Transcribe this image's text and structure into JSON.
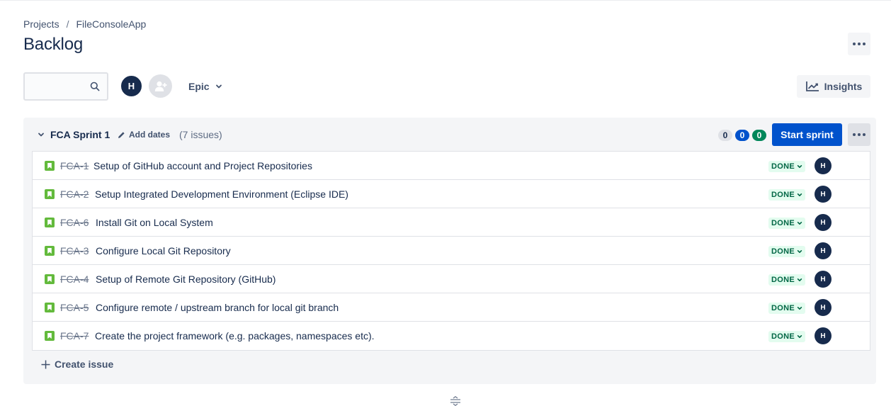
{
  "breadcrumb": {
    "projects": "Projects",
    "separator": "/",
    "project": "FileConsoleApp"
  },
  "page": {
    "title": "Backlog"
  },
  "toolbar": {
    "search_placeholder": "",
    "avatar_initial": "H",
    "epic_label": "Epic",
    "insights_label": "Insights"
  },
  "sprint": {
    "name": "FCA Sprint 1",
    "add_dates": "Add dates",
    "issue_count": "(7 issues)",
    "counts": {
      "todo": "0",
      "in_progress": "0",
      "done": "0"
    },
    "start_label": "Start sprint",
    "create_issue": "Create issue",
    "issues": [
      {
        "key": "FCA-1",
        "summary": "Setup of GitHub account and Project Repositories",
        "status": "DONE",
        "assignee": "H"
      },
      {
        "key": "FCA-2",
        "summary": "Setup Integrated Development Environment (Eclipse IDE)",
        "status": "DONE",
        "assignee": "H"
      },
      {
        "key": "FCA-6",
        "summary": "Install Git on Local System",
        "status": "DONE",
        "assignee": "H"
      },
      {
        "key": "FCA-3",
        "summary": "Configure Local Git Repository",
        "status": "DONE",
        "assignee": "H"
      },
      {
        "key": "FCA-4",
        "summary": "Setup of Remote Git Repository (GitHub)",
        "status": "DONE",
        "assignee": "H"
      },
      {
        "key": "FCA-5",
        "summary": "Configure remote / upstream branch for local git branch",
        "status": "DONE",
        "assignee": "H"
      },
      {
        "key": "FCA-7",
        "summary": "Create the project framework (e.g. packages, namespaces etc).",
        "status": "DONE",
        "assignee": "H"
      }
    ]
  },
  "colors": {
    "primary": "#0052cc",
    "done_bg": "#e3fcef",
    "done_text": "#006644",
    "story": "#63ba3c",
    "avatar": "#172b4d"
  }
}
